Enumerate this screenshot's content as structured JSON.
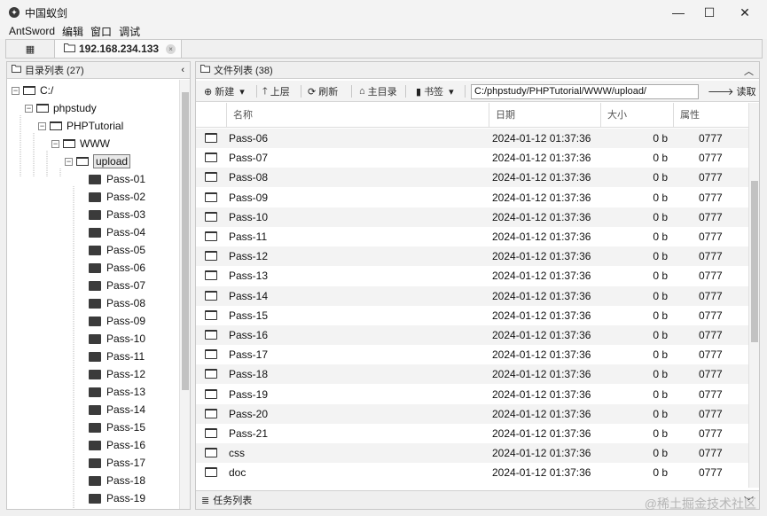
{
  "window": {
    "title": "中国蚁剑",
    "minimize_label": "—",
    "maximize_label": "☐",
    "close_label": "✕"
  },
  "menu": [
    "AntSword",
    "编辑",
    "窗口",
    "调试"
  ],
  "tabs": {
    "home_icon": "grid-icon",
    "host_label": "192.168.234.133",
    "close_glyph": "×"
  },
  "left_panel": {
    "title": "目录列表 (27)",
    "tree": {
      "drive": "C:/",
      "phpstudy": "phpstudy",
      "phptutorial": "PHPTutorial",
      "www": "WWW",
      "upload": "upload",
      "children": [
        "Pass-01",
        "Pass-02",
        "Pass-03",
        "Pass-04",
        "Pass-05",
        "Pass-06",
        "Pass-07",
        "Pass-08",
        "Pass-09",
        "Pass-10",
        "Pass-11",
        "Pass-12",
        "Pass-13",
        "Pass-14",
        "Pass-15",
        "Pass-16",
        "Pass-17",
        "Pass-18",
        "Pass-19"
      ]
    }
  },
  "right_panel": {
    "title": "文件列表 (38)",
    "toolbar": {
      "new_label": "新建",
      "up_label": "上层",
      "refresh_label": "刷新",
      "home_label": "主目录",
      "bookmark_label": "书签",
      "path": "C:/phpstudy/PHPTutorial/WWW/upload/",
      "read_label": "读取"
    },
    "columns": [
      "名称",
      "日期",
      "大小",
      "属性"
    ],
    "rows": [
      [
        "Pass-06",
        "2024-01-12 01:37:36",
        "0 b",
        "0777"
      ],
      [
        "Pass-07",
        "2024-01-12 01:37:36",
        "0 b",
        "0777"
      ],
      [
        "Pass-08",
        "2024-01-12 01:37:36",
        "0 b",
        "0777"
      ],
      [
        "Pass-09",
        "2024-01-12 01:37:36",
        "0 b",
        "0777"
      ],
      [
        "Pass-10",
        "2024-01-12 01:37:36",
        "0 b",
        "0777"
      ],
      [
        "Pass-11",
        "2024-01-12 01:37:36",
        "0 b",
        "0777"
      ],
      [
        "Pass-12",
        "2024-01-12 01:37:36",
        "0 b",
        "0777"
      ],
      [
        "Pass-13",
        "2024-01-12 01:37:36",
        "0 b",
        "0777"
      ],
      [
        "Pass-14",
        "2024-01-12 01:37:36",
        "0 b",
        "0777"
      ],
      [
        "Pass-15",
        "2024-01-12 01:37:36",
        "0 b",
        "0777"
      ],
      [
        "Pass-16",
        "2024-01-12 01:37:36",
        "0 b",
        "0777"
      ],
      [
        "Pass-17",
        "2024-01-12 01:37:36",
        "0 b",
        "0777"
      ],
      [
        "Pass-18",
        "2024-01-12 01:37:36",
        "0 b",
        "0777"
      ],
      [
        "Pass-19",
        "2024-01-12 01:37:36",
        "0 b",
        "0777"
      ],
      [
        "Pass-20",
        "2024-01-12 01:37:36",
        "0 b",
        "0777"
      ],
      [
        "Pass-21",
        "2024-01-12 01:37:36",
        "0 b",
        "0777"
      ],
      [
        "css",
        "2024-01-12 01:37:36",
        "0 b",
        "0777"
      ],
      [
        "doc",
        "2024-01-12 01:37:36",
        "0 b",
        "0777"
      ]
    ]
  },
  "task_panel": {
    "title": "任务列表"
  },
  "watermark": "@稀土掘金技术社区"
}
